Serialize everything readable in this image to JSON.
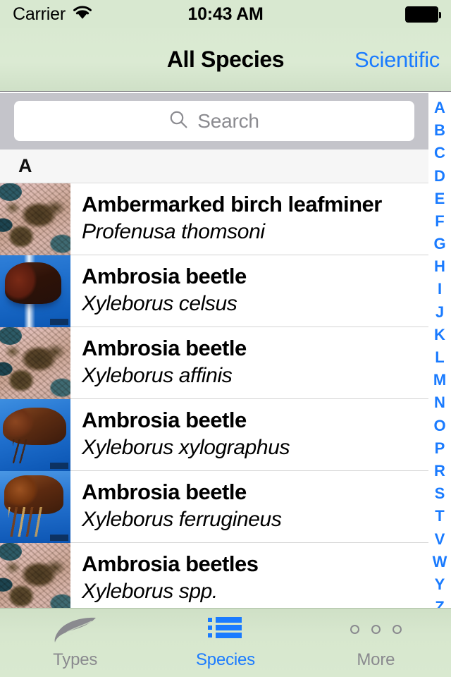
{
  "status_bar": {
    "carrier": "Carrier",
    "wifi_icon": "wifi-icon",
    "time": "10:43 AM",
    "battery_icon": "battery-full-icon"
  },
  "nav_bar": {
    "title": "All Species",
    "right_button": "Scientific"
  },
  "search": {
    "placeholder": "Search",
    "value": "",
    "icon": "search-icon"
  },
  "list": {
    "section_header": "A",
    "rows": [
      {
        "common_name": "Ambermarked birch leafminer",
        "scientific_name": "Profenusa thomsoni",
        "thumb": "leaf-damage-photo"
      },
      {
        "common_name": "Ambrosia beetle",
        "scientific_name": "Xyleborus celsus",
        "thumb": "beetle-photo-dark"
      },
      {
        "common_name": "Ambrosia beetle",
        "scientific_name": "Xyleborus affinis",
        "thumb": "leaf-damage-photo"
      },
      {
        "common_name": "Ambrosia beetle",
        "scientific_name": "Xyleborus xylographus",
        "thumb": "beetle-photo-side"
      },
      {
        "common_name": "Ambrosia beetle",
        "scientific_name": "Xyleborus ferrugineus",
        "thumb": "beetle-photo-legs"
      },
      {
        "common_name": "Ambrosia beetles",
        "scientific_name": "Xyleborus spp.",
        "thumb": "leaf-damage-photo"
      }
    ]
  },
  "index_strip": {
    "letters": [
      "A",
      "B",
      "C",
      "D",
      "E",
      "F",
      "G",
      "H",
      "I",
      "J",
      "K",
      "L",
      "M",
      "N",
      "O",
      "P",
      "R",
      "S",
      "T",
      "V",
      "W",
      "Y",
      "Z"
    ]
  },
  "tab_bar": {
    "tabs": [
      {
        "label": "Types",
        "icon": "leaf-icon",
        "active": false
      },
      {
        "label": "Species",
        "icon": "list-icon",
        "active": true
      },
      {
        "label": "More",
        "icon": "ellipsis-icon",
        "active": true
      }
    ]
  },
  "colors": {
    "accent_blue": "#1a7bff",
    "bar_green": "#d8e8d0",
    "search_gray": "#c4c4ca",
    "inactive_gray": "#8a8a8f"
  }
}
